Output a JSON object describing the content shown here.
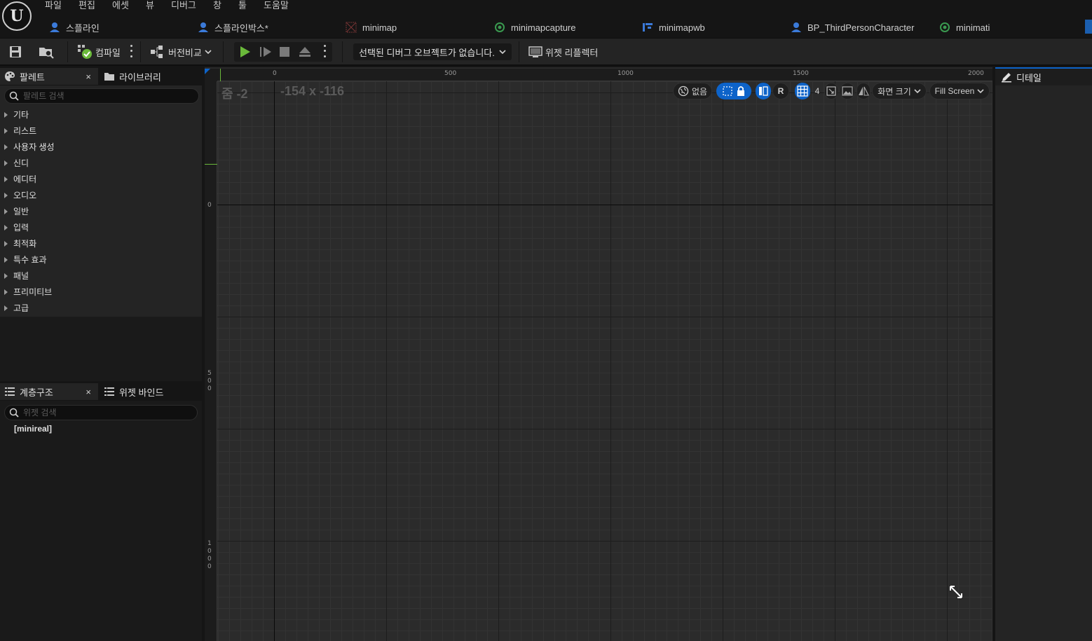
{
  "menu": [
    "파일",
    "편집",
    "에셋",
    "뷰",
    "디버그",
    "창",
    "툴",
    "도움말"
  ],
  "tabs": [
    {
      "label": "스플라인",
      "icon": "user-icon"
    },
    {
      "label": "스플라인박스*",
      "icon": "user-icon"
    },
    {
      "label": "minimap",
      "icon": "material-icon"
    },
    {
      "label": "minimapcapture",
      "icon": "scene-capture-icon"
    },
    {
      "label": "minimapwb",
      "icon": "widget-blueprint-icon"
    },
    {
      "label": "BP_ThirdPersonCharacter",
      "icon": "user-icon"
    },
    {
      "label": "minimati",
      "icon": "scene-capture-icon"
    }
  ],
  "toolbar": {
    "compile_label": "컴파일",
    "diff_label": "버전비교",
    "debug_object": "선택된 디버그 오브젝트가 없습니다.",
    "widget_reflector_label": "위젯 리플렉터"
  },
  "palette": {
    "tab_label": "팔레트",
    "library_tab_label": "라이브러리",
    "search_placeholder": "팔레트 검색",
    "categories": [
      "기타",
      "리스트",
      "사용자 생성",
      "신디",
      "에디터",
      "오디오",
      "일반",
      "입력",
      "최적화",
      "특수 효과",
      "패널",
      "프리미티브",
      "고급"
    ]
  },
  "hierarchy": {
    "tab_label": "계층구조",
    "bindings_tab_label": "위젯 바인드",
    "search_placeholder": "위젯 검색",
    "root_item": "[minireal]"
  },
  "designer": {
    "zoom_text": "줌 -2",
    "coords_text": "-154 x -116",
    "ruler_top": [
      "0",
      "500",
      "1000",
      "1500",
      "2000"
    ],
    "ruler_left_0": "0",
    "ruler_left_500": [
      "5",
      "0",
      "0"
    ],
    "ruler_left_1000": [
      "1",
      "0",
      "0",
      "0"
    ],
    "localization_label": "없음",
    "respect_lock_label": "R",
    "grid_snap_value": "4",
    "screen_size_label": "화면 크기",
    "fill_mode_label": "Fill Screen"
  },
  "details": {
    "tab_label": "디테일"
  },
  "colors": {
    "accent_blue": "#0d63c9",
    "play_green": "#6ab93a",
    "background": "#151515",
    "panel": "#242424"
  }
}
